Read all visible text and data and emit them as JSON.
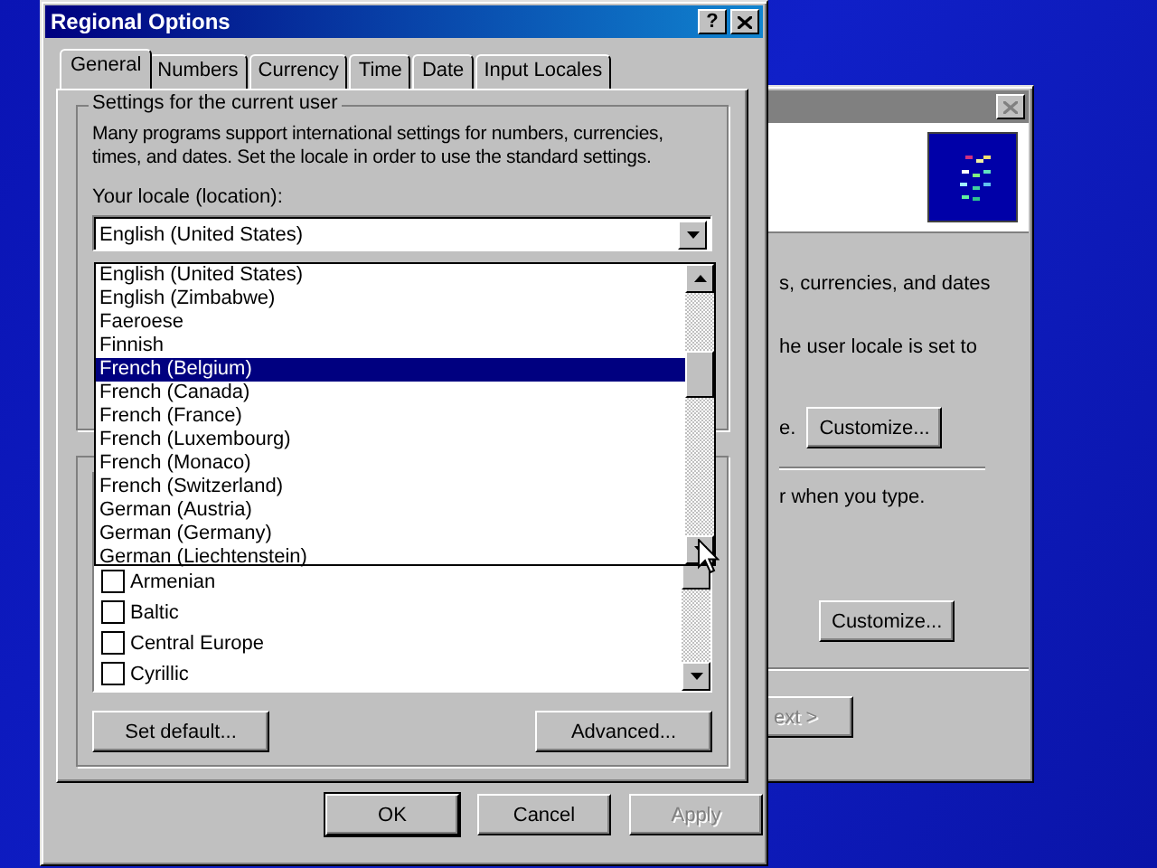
{
  "background_window": {
    "texts": [
      "s, currencies, and dates",
      "he user locale is set to",
      "e.",
      "r when you type."
    ],
    "buttons": [
      {
        "label": "Customize...",
        "disabled": false
      },
      {
        "label": "Customize...",
        "disabled": false
      },
      {
        "label": "ext >",
        "disabled": true
      }
    ]
  },
  "window": {
    "title": "Regional Options",
    "help": "?"
  },
  "tabs": [
    {
      "label": "General",
      "selected": true
    },
    {
      "label": "Numbers",
      "selected": false
    },
    {
      "label": "Currency",
      "selected": false
    },
    {
      "label": "Time",
      "selected": false
    },
    {
      "label": "Date",
      "selected": false
    },
    {
      "label": "Input Locales",
      "selected": false
    }
  ],
  "user_settings": {
    "heading": "Settings for the current user",
    "description": "Many programs support international settings for numbers, currencies, times, and dates. Set the locale in order to use the standard settings.",
    "locale_label": "Your locale (location):",
    "locale_value": "English (United States)",
    "dropdown_items": [
      {
        "label": "English (United States)",
        "selected": false
      },
      {
        "label": "English (Zimbabwe)",
        "selected": false
      },
      {
        "label": "Faeroese",
        "selected": false
      },
      {
        "label": "Finnish",
        "selected": false
      },
      {
        "label": "French (Belgium)",
        "selected": true
      },
      {
        "label": "French (Canada)",
        "selected": false
      },
      {
        "label": "French (France)",
        "selected": false
      },
      {
        "label": "French (Luxembourg)",
        "selected": false
      },
      {
        "label": "French (Monaco)",
        "selected": false
      },
      {
        "label": "French (Switzerland)",
        "selected": false
      },
      {
        "label": "German (Austria)",
        "selected": false
      },
      {
        "label": "German (Germany)",
        "selected": false
      },
      {
        "label": "German (Liechtenstein)",
        "selected": false
      }
    ]
  },
  "language_settings": {
    "items": [
      {
        "label": "Armenian",
        "checked": false
      },
      {
        "label": "Baltic",
        "checked": false
      },
      {
        "label": "Central Europe",
        "checked": false
      },
      {
        "label": "Cyrillic",
        "checked": false
      }
    ],
    "buttons": [
      "Set default...",
      "Advanced..."
    ]
  },
  "buttons": [
    {
      "label": "OK",
      "default": true,
      "disabled": false
    },
    {
      "label": "Cancel",
      "default": false,
      "disabled": false
    },
    {
      "label": "Apply",
      "default": false,
      "disabled": true
    }
  ]
}
